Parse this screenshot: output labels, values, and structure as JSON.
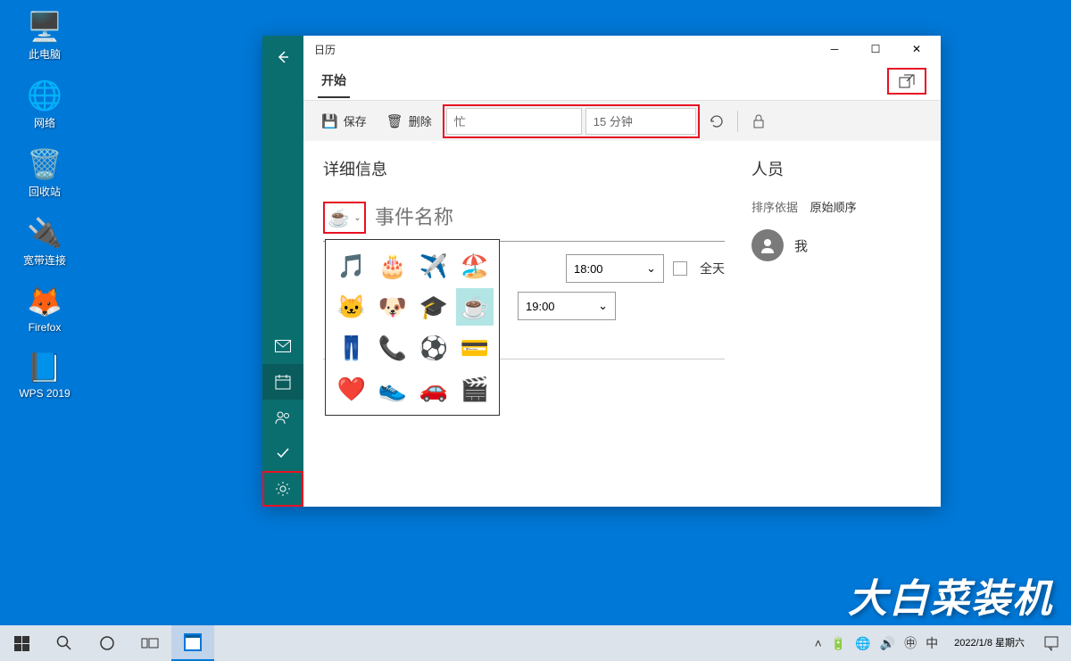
{
  "desktop": {
    "icons": [
      {
        "label": "此电脑",
        "emoji": "🖥️"
      },
      {
        "label": "网络",
        "emoji": "🌐"
      },
      {
        "label": "回收站",
        "emoji": "🗑️"
      },
      {
        "label": "宽带连接",
        "emoji": "🔌"
      },
      {
        "label": "Firefox",
        "emoji": "🦊"
      },
      {
        "label": "WPS 2019",
        "emoji": "📘"
      }
    ]
  },
  "window": {
    "title": "日历",
    "tab_start": "开始",
    "toolbar": {
      "save": "保存",
      "delete": "删除",
      "status": "忙",
      "reminder": "15 分钟"
    },
    "details_title": "详细信息",
    "event_name_placeholder": "事件名称",
    "time_start": "18:00",
    "time_end": "19:00",
    "allday": "全天",
    "people_title": "人员",
    "sort_label": "排序依据",
    "sort_value": "原始顺序",
    "me": "我",
    "icon_grid": [
      "🎵",
      "🎂",
      "✈️",
      "🏖️",
      "🐱",
      "🐶",
      "🎓",
      "☕",
      "👖",
      "📞",
      "⚽",
      "💳",
      "❤️",
      "👟",
      "🚗",
      "🎬"
    ]
  },
  "taskbar": {
    "datetime_line1": "2022/1/8 星期六"
  },
  "watermark": "大白菜装机"
}
